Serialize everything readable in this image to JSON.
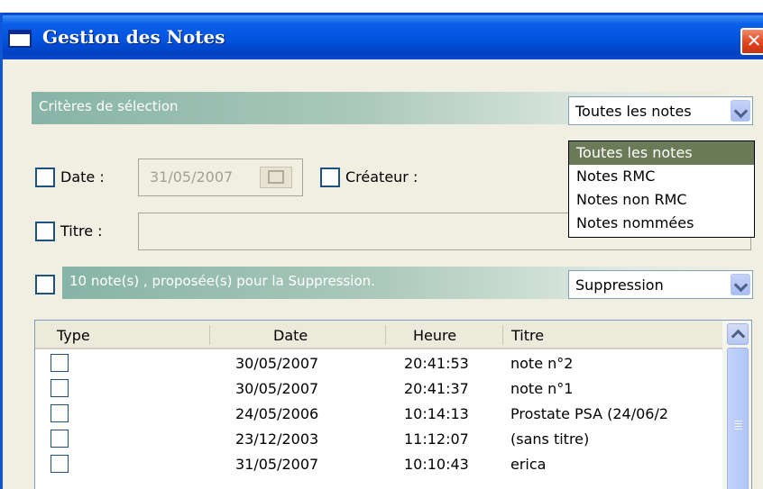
{
  "window": {
    "title": "Gestion des Notes",
    "close_label": "✕"
  },
  "criteria": {
    "header": "Critères de sélection",
    "notes_filter": {
      "value": "Toutes les notes",
      "options": [
        "Toutes les notes",
        "Notes RMC",
        "Notes non RMC",
        "Notes nommées"
      ]
    },
    "date_label": "Date :",
    "date_value": "31/05/2007",
    "createur_label": "Créateur :",
    "titre_label": "Titre :"
  },
  "suppression": {
    "message": "10 note(s) , proposée(s) pour la Suppression.",
    "action": "Suppression"
  },
  "table": {
    "columns": [
      "Type",
      "Date",
      "Heure",
      "Titre"
    ],
    "rows": [
      {
        "date": "30/05/2007",
        "heure": "20:41:53",
        "titre": "note n°2"
      },
      {
        "date": "30/05/2007",
        "heure": "20:41:37",
        "titre": "note n°1"
      },
      {
        "date": "24/05/2006",
        "heure": "10:14:13",
        "titre": "Prostate PSA (24/06/2"
      },
      {
        "date": "23/12/2003",
        "heure": "11:12:07",
        "titre": "(sans titre)"
      },
      {
        "date": "31/05/2007",
        "heure": "10:10:43",
        "titre": "erica"
      }
    ]
  }
}
